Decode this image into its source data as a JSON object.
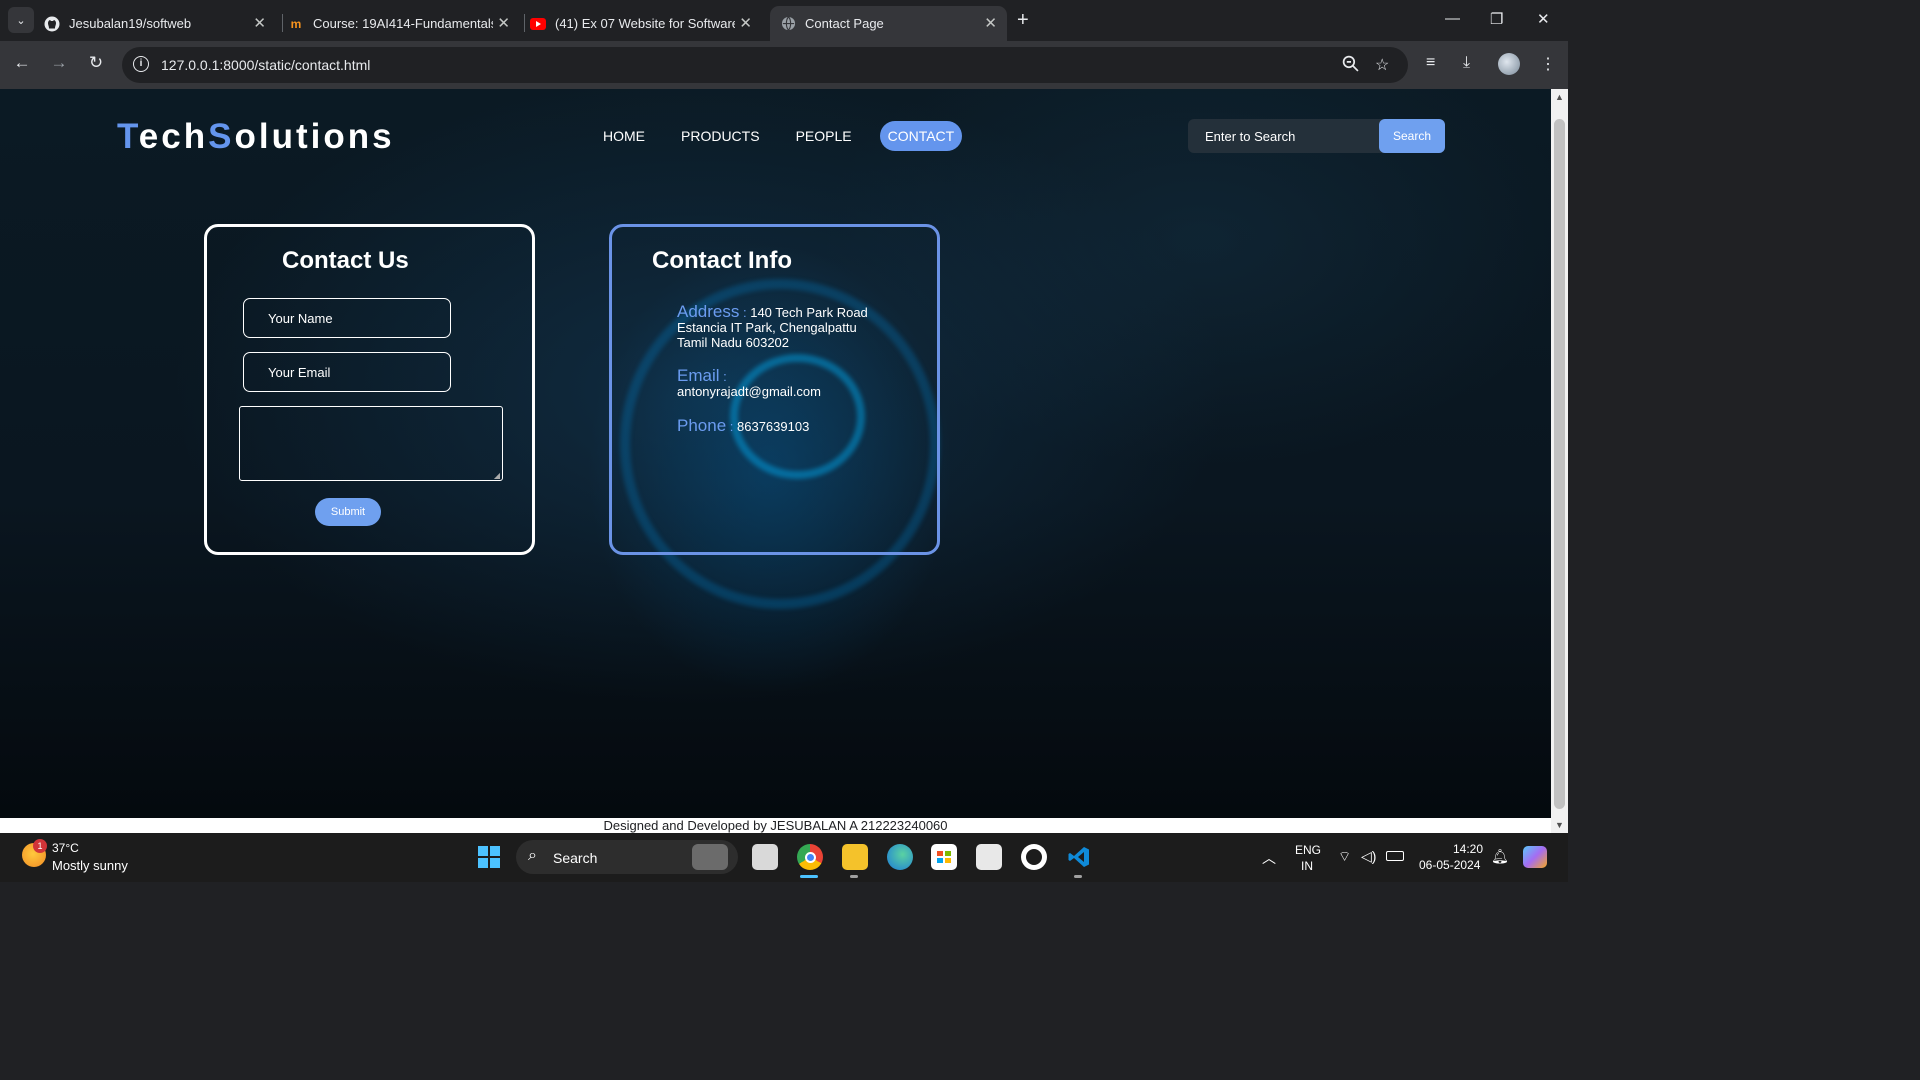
{
  "browser": {
    "tabs": [
      {
        "title": "Jesubalan19/softweb",
        "icon": "github-icon"
      },
      {
        "title": "Course: 19AI414-Fundamentals",
        "icon": "moodle-icon"
      },
      {
        "title": "(41) Ex 07 Website for Software",
        "icon": "youtube-icon"
      },
      {
        "title": "Contact Page",
        "icon": "globe-icon",
        "active": true
      }
    ],
    "url": "127.0.0.1:8000/static/contact.html"
  },
  "site": {
    "logo": {
      "t": "T",
      "ech": "ech",
      "s": "S",
      "olutions": "olutions"
    },
    "nav": [
      "HOME",
      "PRODUCTS",
      "PEOPLE",
      "CONTACT"
    ],
    "active_nav": "CONTACT",
    "search": {
      "placeholder": "Enter to Search",
      "button": "Search"
    },
    "accent": "#6495ed"
  },
  "contact_form": {
    "title": "Contact Us",
    "name_placeholder": "Your Name",
    "email_placeholder": "Your Email",
    "message_value": "",
    "submit": "Submit"
  },
  "contact_info": {
    "title": "Contact Info",
    "address_label": "Address",
    "address_lines": [
      "140 Tech Park Road",
      "Estancia IT Park, Chengalpattu",
      "Tamil Nadu 603202"
    ],
    "email_label": "Email",
    "email": "antonyrajadt@gmail.com",
    "phone_label": "Phone",
    "phone": "8637639103"
  },
  "footer": "Designed and Developed by JESUBALAN A 212223240060",
  "taskbar": {
    "weather": {
      "temp": "37°C",
      "desc": "Mostly sunny",
      "badge": "1"
    },
    "search": "Search",
    "lang1": "ENG",
    "lang2": "IN",
    "time": "14:20",
    "date": "06-05-2024"
  }
}
